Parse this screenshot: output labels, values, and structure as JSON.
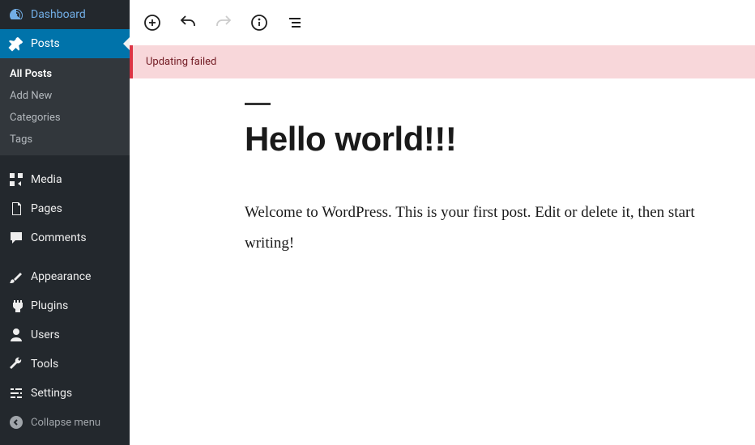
{
  "sidebar": {
    "dashboard": "Dashboard",
    "posts": "Posts",
    "submenu": {
      "all_posts": "All Posts",
      "add_new": "Add New",
      "categories": "Categories",
      "tags": "Tags"
    },
    "media": "Media",
    "pages": "Pages",
    "comments": "Comments",
    "appearance": "Appearance",
    "plugins": "Plugins",
    "users": "Users",
    "tools": "Tools",
    "settings": "Settings",
    "collapse": "Collapse menu"
  },
  "notice": {
    "text": "Updating failed"
  },
  "post": {
    "title": "Hello world!!!",
    "content": "Welcome to WordPress. This is your first post. Edit or delete it, then start writing!"
  }
}
